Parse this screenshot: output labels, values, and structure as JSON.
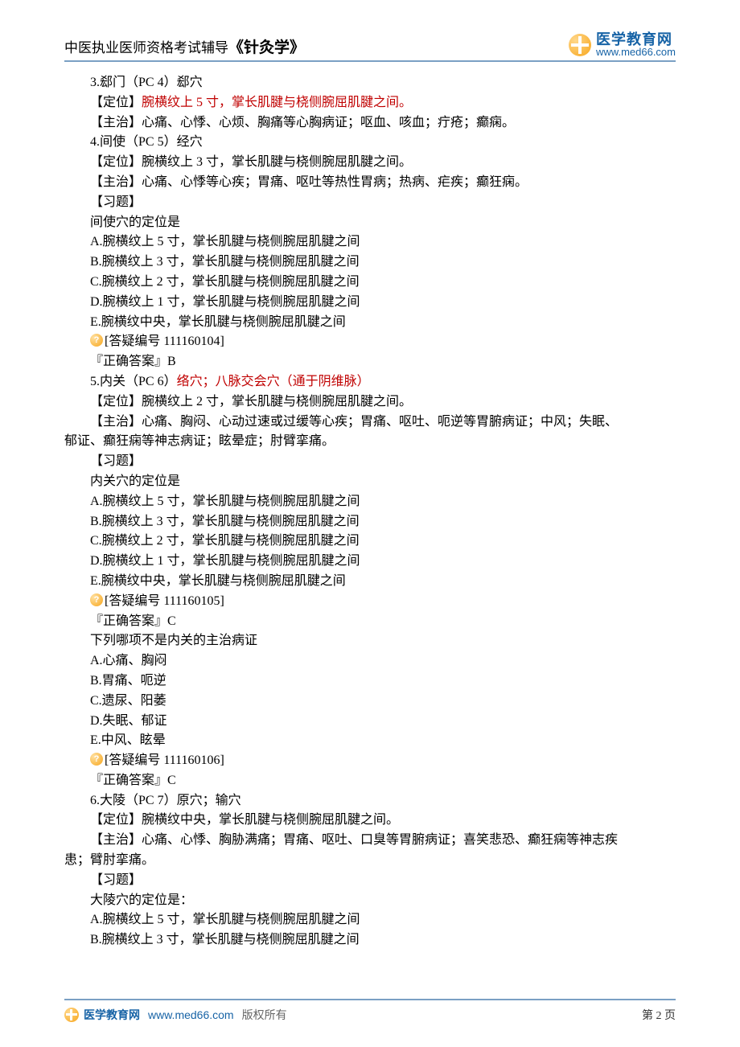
{
  "header": {
    "prefix": "中医执业医师资格考试辅导",
    "subject": "《针灸学》",
    "logo_cn": "医学教育网",
    "logo_url": "www.med66.com"
  },
  "lines": [
    {
      "indent": 1,
      "segs": [
        {
          "t": "3.郄门（PC 4）郄穴"
        }
      ]
    },
    {
      "indent": 1,
      "segs": [
        {
          "t": "【定位】"
        },
        {
          "t": "腕横纹上 5 寸，掌长肌腱与桡侧腕屈肌腱之间。",
          "red": true
        }
      ]
    },
    {
      "indent": 1,
      "segs": [
        {
          "t": "【主治】心痛、心悸、心烦、胸痛等心胸病证；呕血、咳血；疔疮；癫痫。"
        }
      ]
    },
    {
      "indent": 1,
      "segs": [
        {
          "t": "4.间使（PC 5）经穴"
        }
      ]
    },
    {
      "indent": 1,
      "segs": [
        {
          "t": "【定位】腕横纹上 3 寸，掌长肌腱与桡侧腕屈肌腱之间。"
        }
      ]
    },
    {
      "indent": 1,
      "segs": [
        {
          "t": "【主治】心痛、心悸等心疾；胃痛、呕吐等热性胃病；热病、疟疾；癫狂痫。"
        }
      ]
    },
    {
      "indent": 1,
      "segs": [
        {
          "t": "【习题】"
        }
      ]
    },
    {
      "indent": 1,
      "segs": [
        {
          "t": "间使穴的定位是"
        }
      ]
    },
    {
      "indent": 1,
      "segs": [
        {
          "t": "A.腕横纹上 5 寸，掌长肌腱与桡侧腕屈肌腱之间"
        }
      ]
    },
    {
      "indent": 1,
      "segs": [
        {
          "t": "B.腕横纹上 3 寸，掌长肌腱与桡侧腕屈肌腱之间"
        }
      ]
    },
    {
      "indent": 1,
      "segs": [
        {
          "t": "C.腕横纹上 2 寸，掌长肌腱与桡侧腕屈肌腱之间"
        }
      ]
    },
    {
      "indent": 1,
      "segs": [
        {
          "t": "D.腕横纹上 1 寸，掌长肌腱与桡侧腕屈肌腱之间"
        }
      ]
    },
    {
      "indent": 1,
      "segs": [
        {
          "t": "E.腕横纹中央，掌长肌腱与桡侧腕屈肌腱之间"
        }
      ]
    },
    {
      "indent": 1,
      "icon": true,
      "segs": [
        {
          "t": "[答疑编号 111160104]"
        }
      ]
    },
    {
      "indent": 1,
      "segs": [
        {
          "t": "『正确答案』B"
        }
      ]
    },
    {
      "indent": 1,
      "segs": [
        {
          "t": "5.内关（PC 6）"
        },
        {
          "t": "络穴；八脉交会穴（通于阴维脉）",
          "red": true
        }
      ]
    },
    {
      "indent": 1,
      "segs": [
        {
          "t": "【定位】腕横纹上 2 寸，掌长肌腱与桡侧腕屈肌腱之间。"
        }
      ]
    },
    {
      "indent": 1,
      "segs": [
        {
          "t": "【主治】心痛、胸闷、心动过速或过缓等心疾；胃痛、呕吐、呃逆等胃腑病证；中风；失眠、"
        }
      ]
    },
    {
      "indent": 0,
      "segs": [
        {
          "t": "郁证、癫狂痫等神志病证；眩晕症；肘臂挛痛。"
        }
      ]
    },
    {
      "indent": 1,
      "segs": [
        {
          "t": "【习题】"
        }
      ]
    },
    {
      "indent": 1,
      "segs": [
        {
          "t": "内关穴的定位是"
        }
      ]
    },
    {
      "indent": 1,
      "segs": [
        {
          "t": "A.腕横纹上 5 寸，掌长肌腱与桡侧腕屈肌腱之间"
        }
      ]
    },
    {
      "indent": 1,
      "segs": [
        {
          "t": "B.腕横纹上 3 寸，掌长肌腱与桡侧腕屈肌腱之间"
        }
      ]
    },
    {
      "indent": 1,
      "segs": [
        {
          "t": "C.腕横纹上 2 寸，掌长肌腱与桡侧腕屈肌腱之间"
        }
      ]
    },
    {
      "indent": 1,
      "segs": [
        {
          "t": "D.腕横纹上 1 寸，掌长肌腱与桡侧腕屈肌腱之间"
        }
      ]
    },
    {
      "indent": 1,
      "segs": [
        {
          "t": "E.腕横纹中央，掌长肌腱与桡侧腕屈肌腱之间"
        }
      ]
    },
    {
      "indent": 1,
      "icon": true,
      "segs": [
        {
          "t": "[答疑编号 111160105]"
        }
      ]
    },
    {
      "indent": 1,
      "segs": [
        {
          "t": "『正确答案』C"
        }
      ]
    },
    {
      "indent": 1,
      "segs": [
        {
          "t": "下列哪项不是内关的主治病证"
        }
      ]
    },
    {
      "indent": 1,
      "segs": [
        {
          "t": "A.心痛、胸闷"
        }
      ]
    },
    {
      "indent": 1,
      "segs": [
        {
          "t": "B.胃痛、呃逆"
        }
      ]
    },
    {
      "indent": 1,
      "segs": [
        {
          "t": "C.遗尿、阳萎"
        }
      ]
    },
    {
      "indent": 1,
      "segs": [
        {
          "t": "D.失眠、郁证"
        }
      ]
    },
    {
      "indent": 1,
      "segs": [
        {
          "t": "E.中风、眩晕"
        }
      ]
    },
    {
      "indent": 1,
      "icon": true,
      "segs": [
        {
          "t": "[答疑编号 111160106]"
        }
      ]
    },
    {
      "indent": 1,
      "segs": [
        {
          "t": "『正确答案』C"
        }
      ]
    },
    {
      "indent": 1,
      "segs": [
        {
          "t": "6.大陵（PC 7）原穴；输穴"
        }
      ]
    },
    {
      "indent": 1,
      "segs": [
        {
          "t": "【定位】腕横纹中央，掌长肌腱与桡侧腕屈肌腱之间。"
        }
      ]
    },
    {
      "indent": 1,
      "segs": [
        {
          "t": "【主治】心痛、心悸、胸胁满痛；胃痛、呕吐、口臭等胃腑病证；喜笑悲恐、癫狂痫等神志疾"
        }
      ]
    },
    {
      "indent": 0,
      "segs": [
        {
          "t": "患；臂肘挛痛。"
        }
      ]
    },
    {
      "indent": 1,
      "segs": [
        {
          "t": "【习题】"
        }
      ]
    },
    {
      "indent": 1,
      "segs": [
        {
          "t": "大陵穴的定位是："
        }
      ]
    },
    {
      "indent": 1,
      "segs": [
        {
          "t": "A.腕横纹上 5 寸，掌长肌腱与桡侧腕屈肌腱之间"
        }
      ]
    },
    {
      "indent": 1,
      "segs": [
        {
          "t": "B.腕横纹上 3 寸，掌长肌腱与桡侧腕屈肌腱之间"
        }
      ]
    }
  ],
  "footer": {
    "brand": "医学教育网",
    "url": "www.med66.com",
    "copy": "版权所有",
    "page": "第 2 页"
  }
}
